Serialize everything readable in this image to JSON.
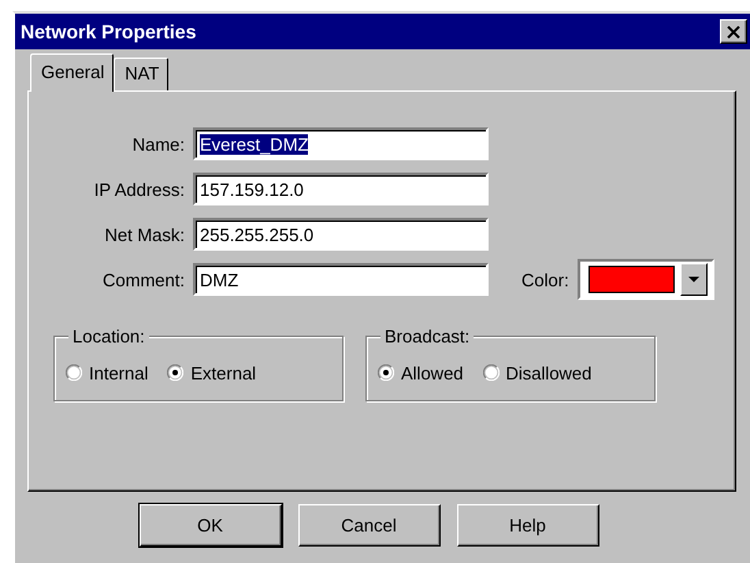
{
  "window": {
    "title": "Network Properties"
  },
  "tabs": [
    {
      "label": "General",
      "selected": true
    },
    {
      "label": "NAT",
      "selected": false
    }
  ],
  "fields": [
    {
      "label": "Name:",
      "value": "Everest_DMZ",
      "text_selected": true
    },
    {
      "label": "IP Address:",
      "value": "157.159.12.0",
      "text_selected": false
    },
    {
      "label": "Net Mask:",
      "value": "255.255.255.0",
      "text_selected": false
    },
    {
      "label": "Comment:",
      "value": "DMZ",
      "text_selected": false
    }
  ],
  "color_picker": {
    "label": "Color:",
    "color": "#ff0000"
  },
  "groups": [
    {
      "title": "Location:",
      "options": [
        {
          "label": "Internal",
          "selected": false
        },
        {
          "label": "External",
          "selected": true
        }
      ]
    },
    {
      "title": "Broadcast:",
      "options": [
        {
          "label": "Allowed",
          "selected": true
        },
        {
          "label": "Disallowed",
          "selected": false
        }
      ]
    }
  ],
  "buttons": [
    {
      "label": "OK",
      "default": true
    },
    {
      "label": "Cancel",
      "default": false
    },
    {
      "label": "Help",
      "default": false
    }
  ]
}
